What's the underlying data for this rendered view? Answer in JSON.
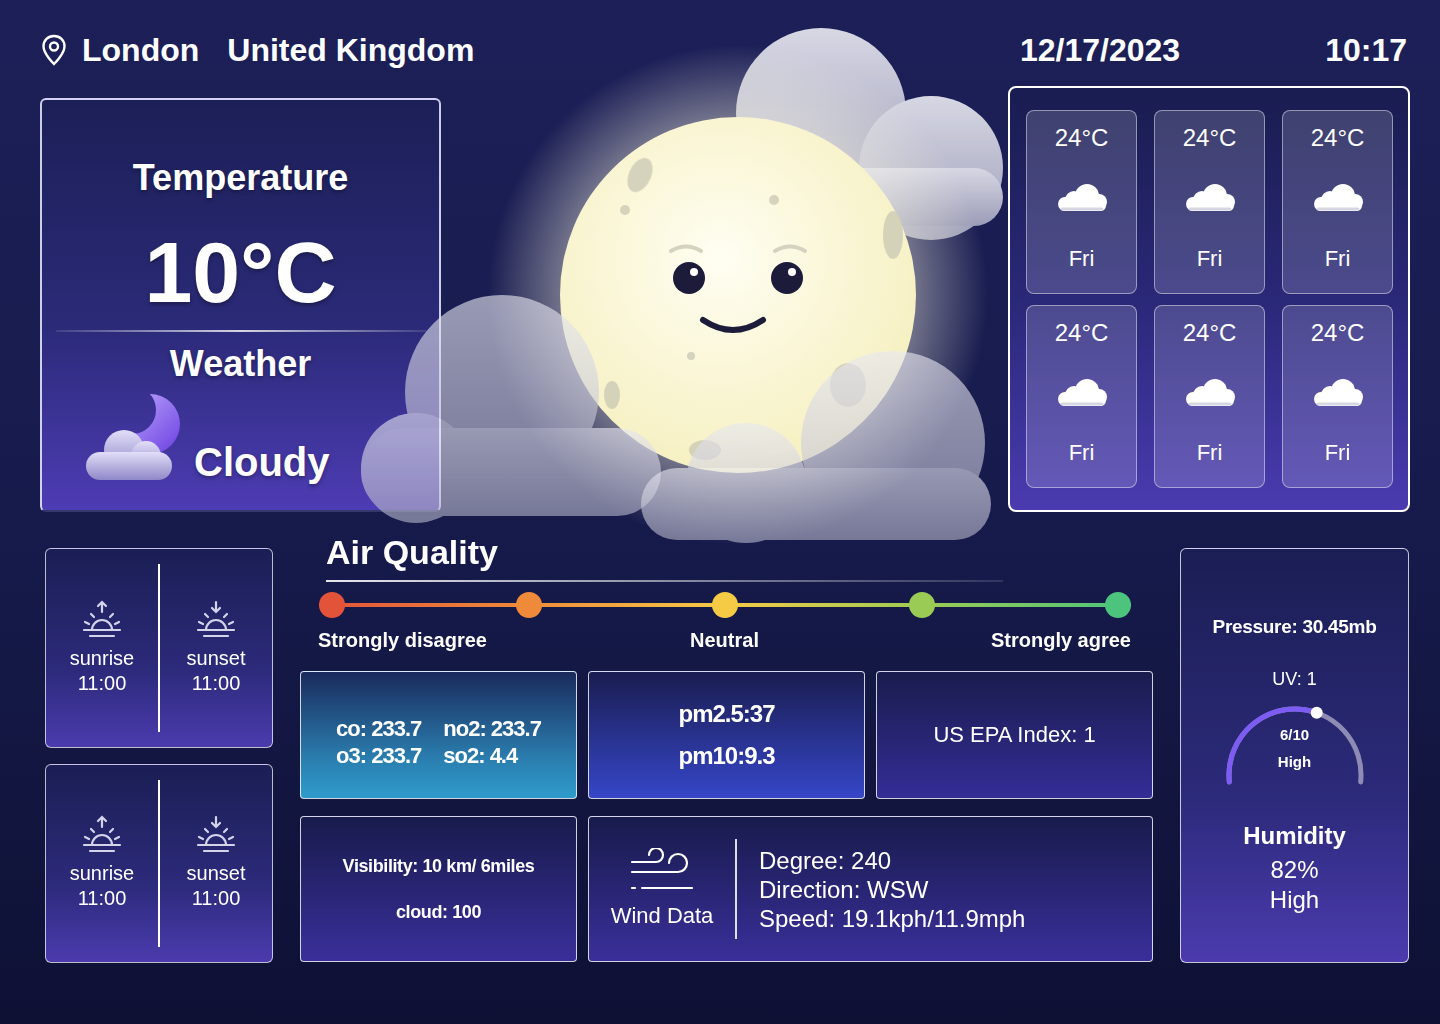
{
  "header": {
    "city": "London",
    "country": "United Kingdom",
    "date": "12/17/2023",
    "time": "10:17"
  },
  "current": {
    "temperature_label": "Temperature",
    "temperature": "10°C",
    "weather_label": "Weather",
    "condition": "Cloudy"
  },
  "forecast": [
    {
      "temp": "24°C",
      "day": "Fri"
    },
    {
      "temp": "24°C",
      "day": "Fri"
    },
    {
      "temp": "24°C",
      "day": "Fri"
    },
    {
      "temp": "24°C",
      "day": "Fri"
    },
    {
      "temp": "24°C",
      "day": "Fri"
    },
    {
      "temp": "24°C",
      "day": "Fri"
    }
  ],
  "sun_cards": [
    {
      "sunrise_label": "sunrise",
      "sunrise": "11:00",
      "sunset_label": "sunset",
      "sunset": "11:00"
    },
    {
      "sunrise_label": "sunrise",
      "sunrise": "11:00",
      "sunset_label": "sunset",
      "sunset": "11:00"
    }
  ],
  "air_quality": {
    "title": "Air Quality",
    "scale": {
      "points": [
        {
          "color": "#e2533a"
        },
        {
          "color": "#ee8a3a"
        },
        {
          "color": "#f5cb45"
        },
        {
          "color": "#9acb55"
        },
        {
          "color": "#4cc47d"
        }
      ],
      "labels": [
        "Strongly disagree",
        "Neutral",
        "Strongly agree"
      ]
    },
    "pollutants": [
      "co: 233.7",
      "no2: 233.7",
      "o3: 233.7",
      "so2: 4.4"
    ],
    "particulates": [
      "pm2.5:37",
      "pm10:9.3"
    ],
    "epa": "US EPA Index: 1"
  },
  "visibility": {
    "visibility": "Visibility: 10 km/ 6miles",
    "cloud": "cloud: 100"
  },
  "wind": {
    "label": "Wind Data",
    "details": [
      "Degree: 240",
      "Direction: WSW",
      "Speed: 19.1kph/11.9mph"
    ]
  },
  "stats": {
    "pressure": "Pressure: 30.45mb",
    "uv": "UV: 1",
    "uv_gauge": {
      "level": 0.6,
      "reading": "6/10",
      "rating": "High"
    },
    "humidity_label": "Humidity",
    "humidity": "82%",
    "humidity_rating": "High"
  }
}
